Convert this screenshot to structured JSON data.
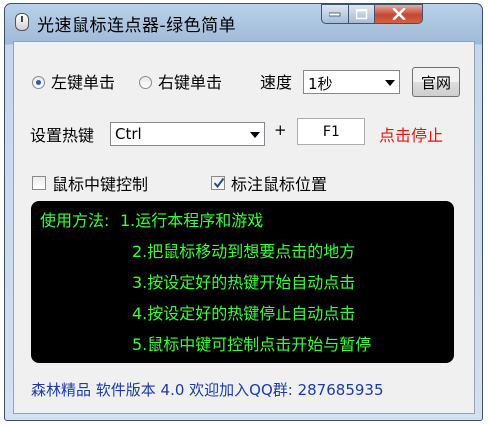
{
  "window": {
    "title": "光速鼠标连点器-绿色简单",
    "icon": "mouse-icon"
  },
  "click_mode": {
    "left_label": "左键单击",
    "right_label": "右键单击",
    "selected": "left"
  },
  "speed": {
    "label": "速度",
    "value": "1秒"
  },
  "official_button": "官网",
  "hotkey": {
    "label": "设置热键",
    "modifier": "Ctrl",
    "plus": "+",
    "key": "F1",
    "status": "点击停止",
    "status_color": "#e8140a"
  },
  "options": {
    "middle_control_label": "鼠标中键控制",
    "middle_control_checked": false,
    "mark_position_label": "标注鼠标位置",
    "mark_position_checked": true
  },
  "instructions": {
    "heading": "使用方法:",
    "steps": [
      "1.运行本程序和游戏",
      "2.把鼠标移动到想要点击的地方",
      "3.按设定好的热键开始自动点击",
      "4.按设定好的热键停止自动点击",
      "5.鼠标中键可控制点击开始与暂停"
    ],
    "text_color": "#3aff3a"
  },
  "footer": "森林精品 软件版本 4.0 欢迎加入QQ群: 287685935"
}
